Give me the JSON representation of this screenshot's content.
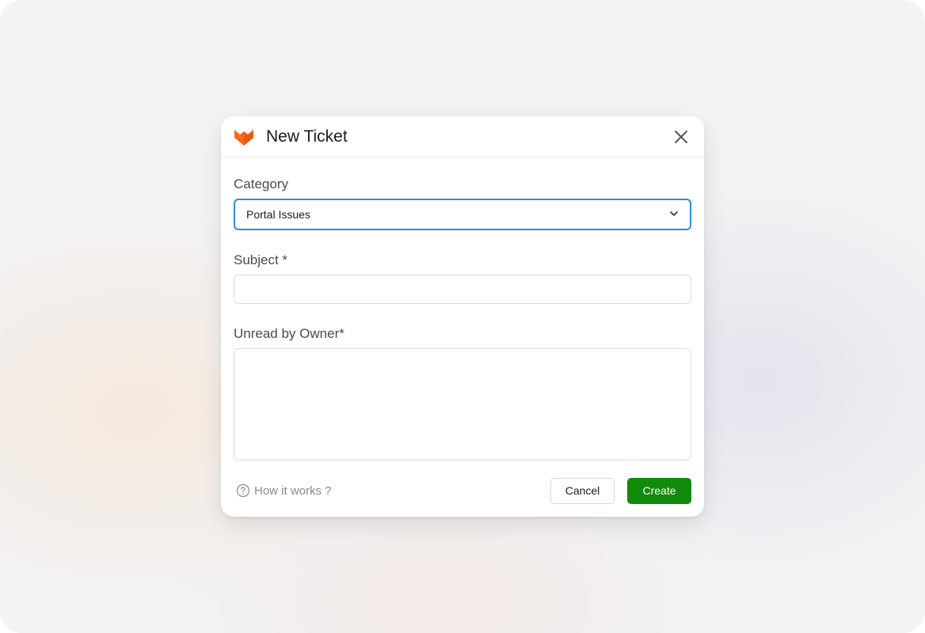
{
  "modal": {
    "title": "New Ticket",
    "logo_icon": "fox-logo-icon",
    "close_icon": "close-icon"
  },
  "form": {
    "category": {
      "label": "Category",
      "selected": "Portal Issues"
    },
    "subject": {
      "label": "Subject *",
      "value": ""
    },
    "unread_by_owner": {
      "label": "Unread by Owner*",
      "value": ""
    }
  },
  "footer": {
    "help_text": "How it works ?",
    "cancel_label": "Cancel",
    "create_label": "Create"
  },
  "colors": {
    "accent_border": "#2b8fd6",
    "create_button": "#128a0c",
    "logo_orange": "#f26b1d"
  }
}
